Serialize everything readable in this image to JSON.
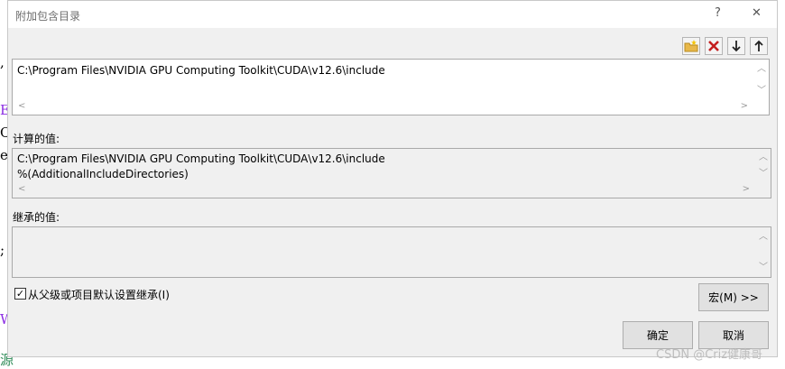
{
  "window": {
    "title": "附加包含目录",
    "help_label": "?",
    "close_label": "✕"
  },
  "toolbar": {
    "new_line_icon": "new-folder-icon",
    "delete_icon": "delete-x-icon",
    "move_down_icon": "arrow-down-icon",
    "move_up_icon": "arrow-up-icon"
  },
  "edit_box": {
    "lines": [
      "C:\\Program Files\\NVIDIA GPU Computing Toolkit\\CUDA\\v12.6\\include"
    ]
  },
  "evaluated": {
    "label": "计算的值:",
    "lines": [
      "C:\\Program Files\\NVIDIA GPU Computing Toolkit\\CUDA\\v12.6\\include",
      "%(AdditionalIncludeDirectories)"
    ]
  },
  "inherited": {
    "label": "继承的值:",
    "lines": []
  },
  "inherit_checkbox": {
    "label": "从父级或项目默认设置继承(I)",
    "checked": true
  },
  "buttons": {
    "macro": "宏(M) >>",
    "ok": "确定",
    "cancel": "取消"
  },
  "background": {
    "chars": [
      ",",
      "E",
      "C",
      "e",
      ";",
      "W",
      "源"
    ]
  },
  "watermark": "CSDN @Criz健康哥"
}
